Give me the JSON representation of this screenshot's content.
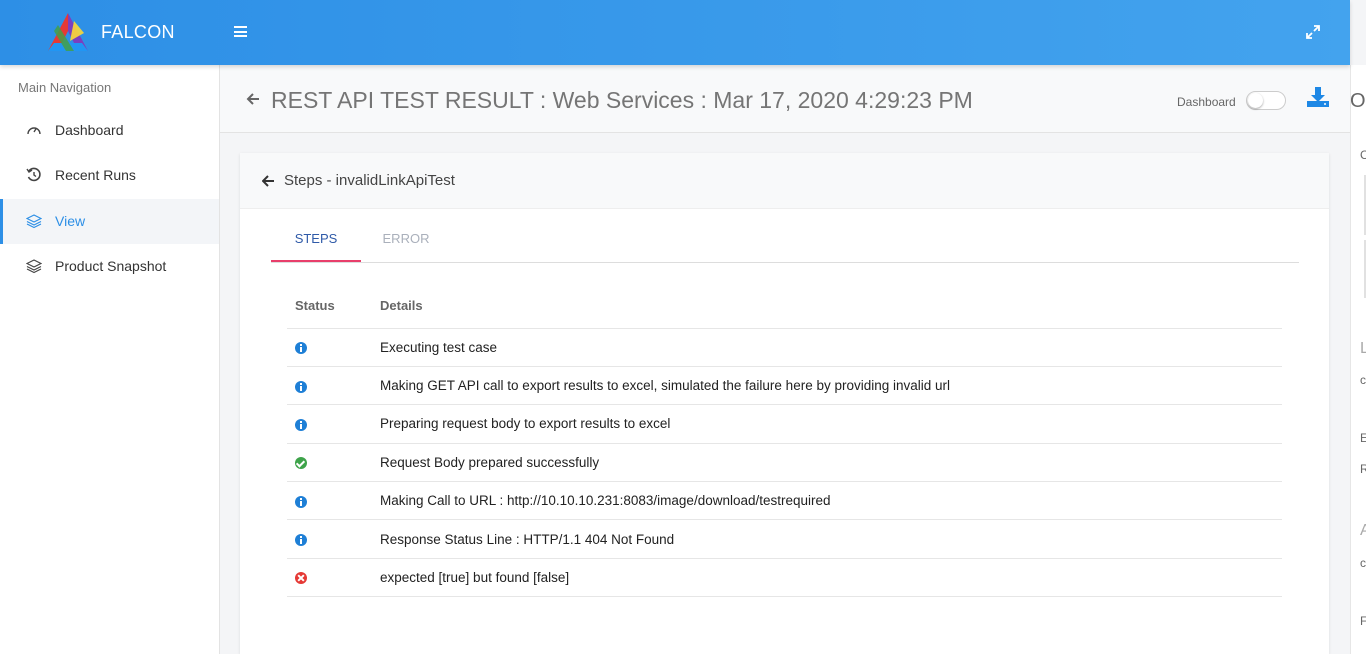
{
  "app": {
    "brand": "FALCON"
  },
  "sidebar": {
    "heading": "Main Navigation",
    "items": [
      {
        "label": "Dashboard",
        "icon": "gauge-icon"
      },
      {
        "label": "Recent Runs",
        "icon": "history-icon"
      },
      {
        "label": "View",
        "icon": "layers-icon",
        "active": true
      },
      {
        "label": "Product Snapshot",
        "icon": "layers-icon"
      }
    ]
  },
  "header": {
    "title": "REST API TEST RESULT : Web Services : Mar 17, 2020 4:29:23 PM",
    "dashboard_label": "Dashboard",
    "right_clipped": "O"
  },
  "card": {
    "title": "Steps - invalidLinkApiTest",
    "tabs": [
      {
        "label": "STEPS",
        "active": true
      },
      {
        "label": "ERROR",
        "active": false
      }
    ],
    "columns": [
      "Status",
      "Details"
    ],
    "rows": [
      {
        "status": "info",
        "details": "Executing test case"
      },
      {
        "status": "info",
        "details": "Making GET API call to export results to excel, simulated the failure here by providing invalid url"
      },
      {
        "status": "info",
        "details": "Preparing request body to export results to excel"
      },
      {
        "status": "success",
        "details": "Request Body prepared successfully"
      },
      {
        "status": "info",
        "details": "Making Call to URL : http://10.10.10.231:8083/image/download/testrequired"
      },
      {
        "status": "info",
        "details": "Response Status Line : HTTP/1.1 404 Not Found"
      },
      {
        "status": "fail",
        "details": "expected [true] but found [false]"
      }
    ]
  },
  "right_strip": {
    "letters": [
      "C",
      "L",
      "c",
      "E",
      "R",
      "A",
      "c",
      "F"
    ]
  },
  "colors": {
    "accent": "#2d8fe6",
    "tab_underline": "#e83e6b",
    "info": "#1e7fd6",
    "success": "#3ea34a",
    "fail": "#e53935"
  }
}
